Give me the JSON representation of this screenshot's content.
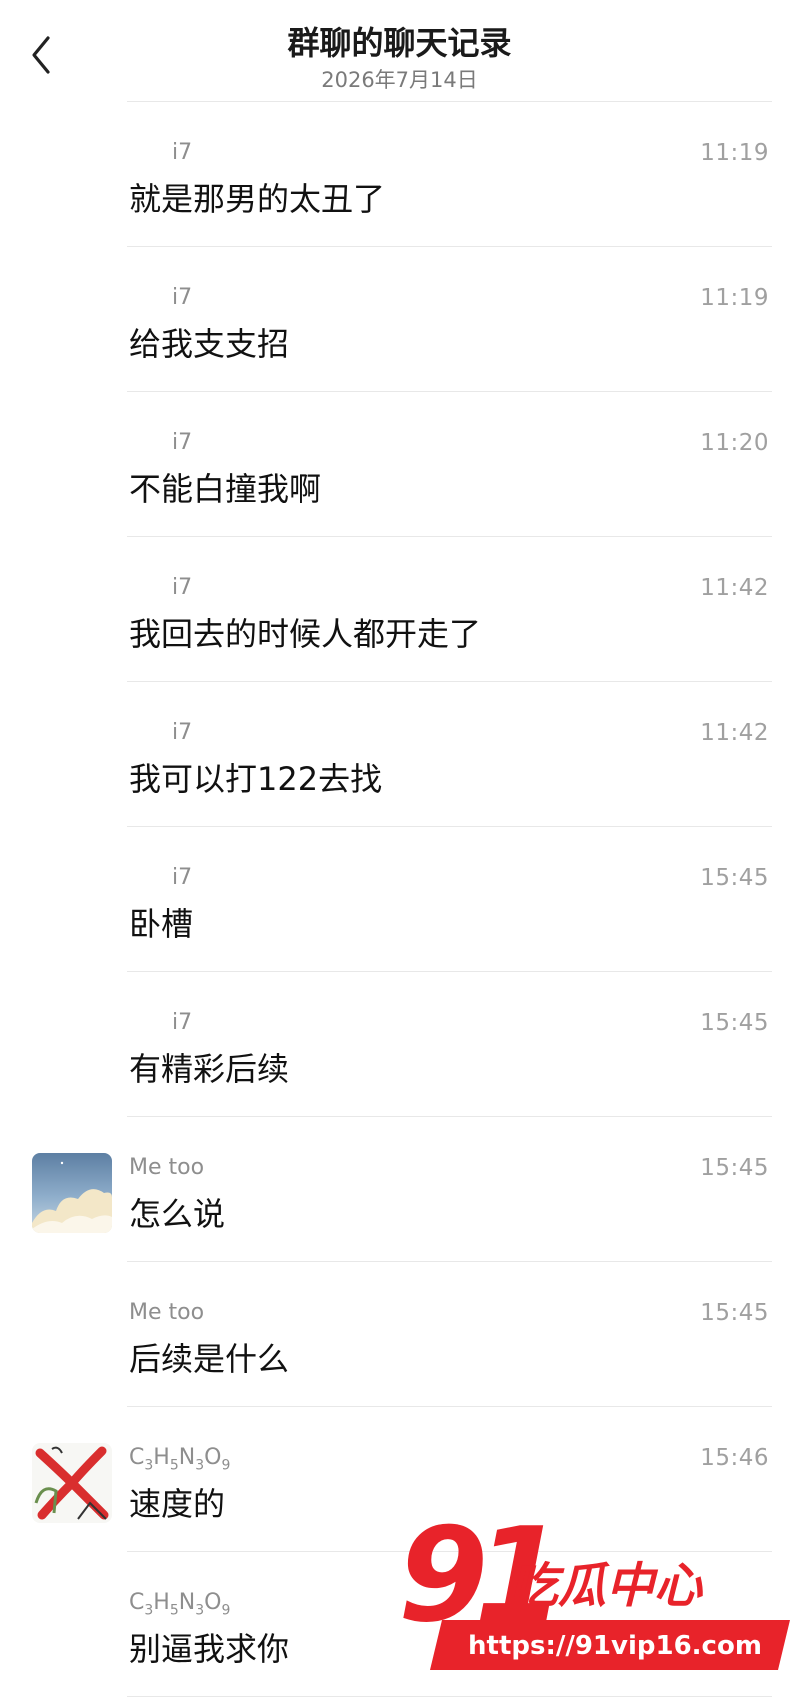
{
  "header": {
    "title": "群聊的聊天记录",
    "date": "2026年7月14日"
  },
  "messages": [
    {
      "sender": "i7",
      "time": "11:19",
      "text": "就是那男的太丑了",
      "avatar": null
    },
    {
      "sender": "i7",
      "time": "11:19",
      "text": "给我支支招",
      "avatar": null
    },
    {
      "sender": "i7",
      "time": "11:20",
      "text": "不能白撞我啊",
      "avatar": null
    },
    {
      "sender": "i7",
      "time": "11:42",
      "text": "我回去的时候人都开走了",
      "avatar": null
    },
    {
      "sender": "i7",
      "time": "11:42",
      "text": "我可以打122去找",
      "avatar": null
    },
    {
      "sender": "i7",
      "time": "15:45",
      "text": "卧槽",
      "avatar": null
    },
    {
      "sender": "i7",
      "time": "15:45",
      "text": "有精彩后续",
      "avatar": null
    },
    {
      "sender": "Me too",
      "time": "15:45",
      "text": "怎么说",
      "avatar": "sky-clouds"
    },
    {
      "sender": "Me too",
      "time": "15:45",
      "text": "后续是什么",
      "avatar": null
    },
    {
      "sender": "C3H5N3O9",
      "time": "15:46",
      "text": "速度的",
      "avatar": "red-cross-drawing"
    },
    {
      "sender": "C3H5N3O9",
      "time": "",
      "text": "别逼我求你",
      "avatar": null
    }
  ],
  "watermark": {
    "logo_text": "91吃瓜中心",
    "url": "https://91vip16.com"
  },
  "icons": {
    "back": "chevron-left-icon"
  }
}
